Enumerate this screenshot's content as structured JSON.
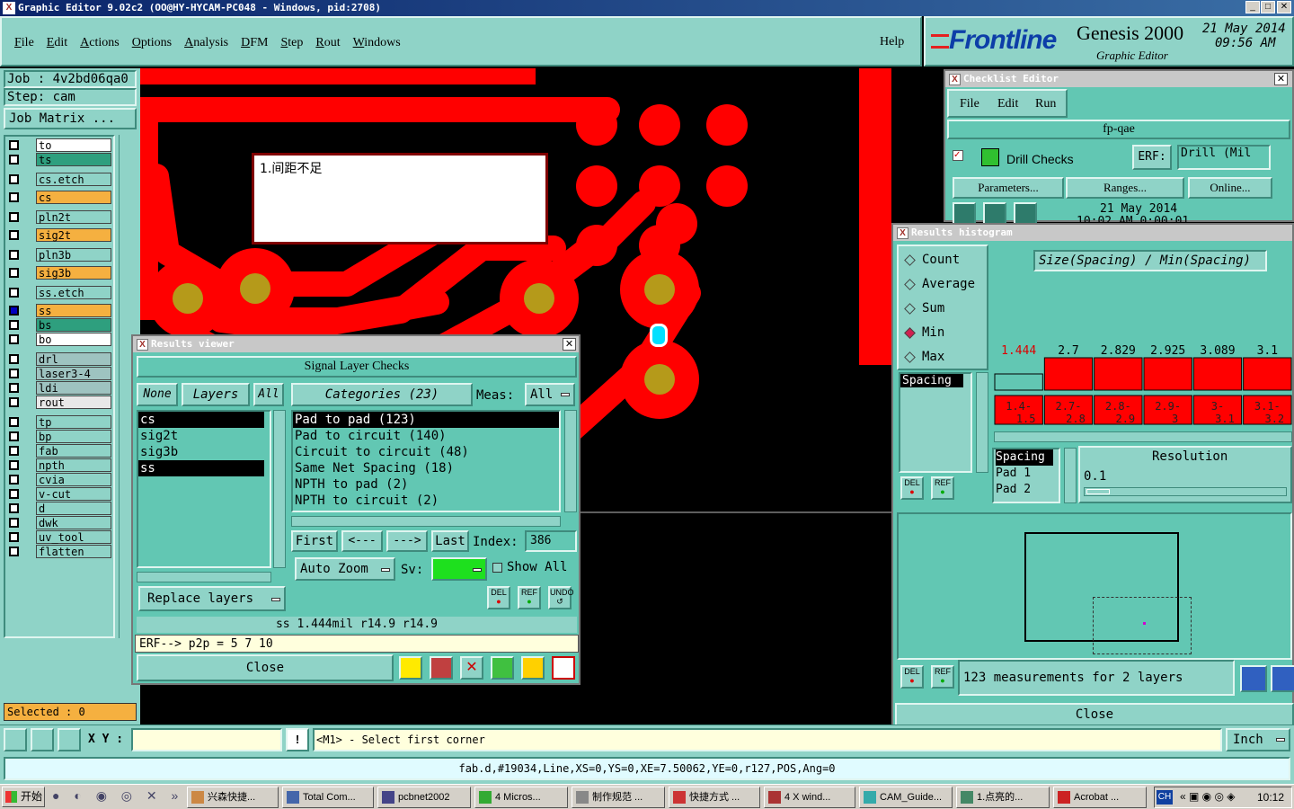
{
  "window": {
    "title": "Graphic Editor 9.02c2 (OO@HY-HYCAM-PC048 - Windows, pid:2708)"
  },
  "menu": [
    "File",
    "Edit",
    "Actions",
    "Options",
    "Analysis",
    "DFM",
    "Step",
    "Rout",
    "Windows"
  ],
  "help": "Help",
  "brand": {
    "logo": "Frontline",
    "product": "Genesis 2000",
    "subtitle": "Graphic Editor",
    "date": "21 May 2014",
    "time": "09:56 AM"
  },
  "job": {
    "job": "Job : 4v2bd06qa0",
    "step": "Step: cam",
    "matrix": "Job Matrix ..."
  },
  "layers": [
    {
      "name": "to",
      "color": "#ffffff"
    },
    {
      "name": "ts",
      "color": "#2e9f7e"
    },
    {
      "name": "cs.etch",
      "color": "#8fd3c7"
    },
    {
      "name": "cs",
      "color": "#f5b040"
    },
    {
      "name": "pln2t",
      "color": "#8fd3c7"
    },
    {
      "name": "sig2t",
      "color": "#f5b040"
    },
    {
      "name": "pln3b",
      "color": "#8fd3c7"
    },
    {
      "name": "sig3b",
      "color": "#f5b040"
    },
    {
      "name": "ss.etch",
      "color": "#8fd3c7"
    },
    {
      "name": "ss",
      "color": "#f5b040"
    },
    {
      "name": "bs",
      "color": "#2e9f7e"
    },
    {
      "name": "bo",
      "color": "#ffffff"
    },
    {
      "name": "drl",
      "color": "#9ec3c0"
    },
    {
      "name": "laser3-4",
      "color": "#9ec3c0"
    },
    {
      "name": "ldi",
      "color": "#9ec3c0"
    },
    {
      "name": "rout",
      "color": "#e8e8e8"
    },
    {
      "name": "tp",
      "color": "#8fd3c7"
    },
    {
      "name": "bp",
      "color": "#8fd3c7"
    },
    {
      "name": "fab",
      "color": "#8fd3c7"
    },
    {
      "name": "npth",
      "color": "#8fd3c7"
    },
    {
      "name": "cvia",
      "color": "#8fd3c7"
    },
    {
      "name": "v-cut",
      "color": "#8fd3c7"
    },
    {
      "name": "d",
      "color": "#8fd3c7"
    },
    {
      "name": "dwk",
      "color": "#8fd3c7"
    },
    {
      "name": "uv_tool",
      "color": "#8fd3c7"
    },
    {
      "name": "flatten",
      "color": "#8fd3c7"
    }
  ],
  "selected": "Selected : 0",
  "canvas": {
    "note": "1.间距不足"
  },
  "results_viewer": {
    "title": "Results viewer",
    "header": "Signal Layer Checks",
    "none": "None",
    "layers_btn": "Layers",
    "all": "All",
    "categories_btn": "Categories (23)",
    "meas_label": "Meas:",
    "meas_value": "All",
    "layer_list": [
      "cs",
      "sig2t",
      "sig3b",
      "ss"
    ],
    "categories": [
      "Pad to pad (123)",
      "Pad to circuit (140)",
      "Circuit to circuit (48)",
      "Same Net Spacing (18)",
      "NPTH to pad (2)",
      "NPTH to circuit (2)"
    ],
    "first": "First",
    "prev": "<---",
    "next": "--->",
    "last": "Last",
    "index_label": "Index:",
    "index_value": "386",
    "auto_zoom": "Auto Zoom",
    "sv_label": "Sv:",
    "show_all": "Show All",
    "replace_layers": "Replace layers",
    "del": "DEL",
    "ref": "REF",
    "undo": "UNDO",
    "status": "ss 1.444mil   r14.9   r14.9",
    "erf": "ERF--> p2p = 5 7 10",
    "close": "Close"
  },
  "checklist": {
    "title": "Checklist Editor",
    "menu": [
      "File",
      "Edit",
      "Run"
    ],
    "name": "fp-qae",
    "item": "Drill Checks",
    "erf": "ERF:",
    "erf_value": "Drill (Mil",
    "parameters": "Parameters...",
    "ranges": "Ranges...",
    "online": "Online...",
    "date": "21 May 2014",
    "time": "10:02 AM   0:00:01"
  },
  "histogram": {
    "title": "Results histogram",
    "options": [
      {
        "label": "Count",
        "selected": false
      },
      {
        "label": "Average",
        "selected": false
      },
      {
        "label": "Sum",
        "selected": false
      },
      {
        "label": "Min",
        "selected": true
      },
      {
        "label": "Max",
        "selected": false
      }
    ],
    "formula": "Size(Spacing) / Min(Spacing)",
    "spacing_list": [
      "Spacing"
    ],
    "sel_list": [
      "Spacing",
      "Pad 1",
      "Pad 2"
    ],
    "resolution_label": "Resolution",
    "resolution_value": "0.1",
    "summary": "123 measurements for 2 layers",
    "close": "Close",
    "del": "DEL",
    "ref": "REF"
  },
  "chart_data": {
    "type": "bar",
    "categories": [
      "1.4-1.5",
      "2.7-2.8",
      "2.8-2.9",
      "2.9-3",
      "3-3.1",
      "3.1-3.2"
    ],
    "values": [
      1.444,
      2.7,
      2.829,
      2.925,
      3.089,
      3.1
    ],
    "labels": [
      "1.444",
      "2.7",
      "2.829",
      "2.925",
      "3.089",
      "3.1"
    ],
    "highlight_color": "#ff0000"
  },
  "bottom": {
    "xy_label": "X Y :",
    "prompt": "<M1> - Select first corner",
    "units": "Inch",
    "status": "fab.d,#19034,Line,XS=0,YS=0,XE=7.50062,YE=0,r127,POS,Ang=0"
  },
  "taskbar": {
    "start": "开始",
    "tasks": [
      "兴森快捷...",
      "Total Com...",
      "pcbnet2002",
      "4 Micros...",
      "制作规范 ...",
      "快捷方式 ...",
      "4 X wind...",
      "CAM_Guide...",
      "1.点亮的...",
      "Acrobat ..."
    ],
    "lang": "CH",
    "clock": "10:12"
  }
}
